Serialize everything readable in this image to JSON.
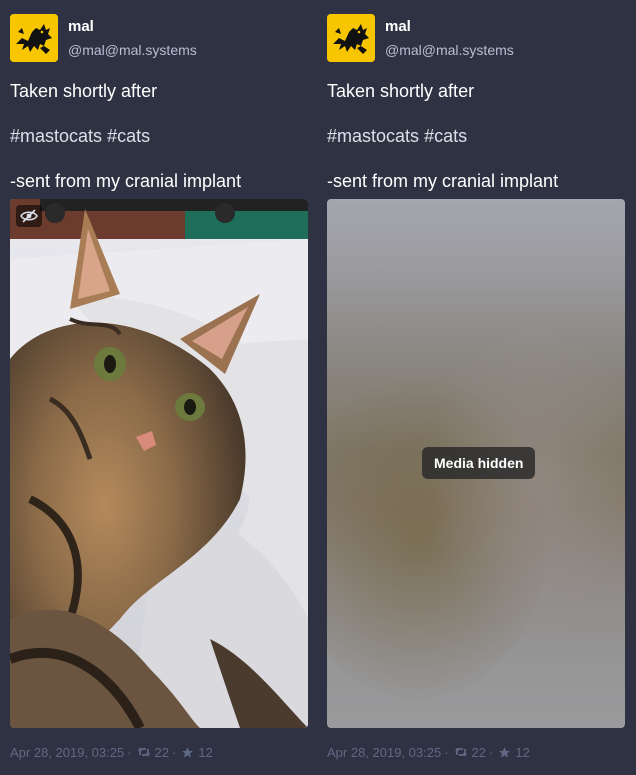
{
  "statuses": [
    {
      "author": {
        "display_name": "mal",
        "acct": "@mal@mal.systems",
        "avatar_icon": "black-cat-silhouette-icon"
      },
      "content": {
        "line1": "Taken shortly after",
        "hashtags": [
          "#mastocats",
          "#cats"
        ],
        "line3": "-sent from my cranial implant"
      },
      "media": {
        "state": "shown",
        "toggle_icon": "eye-slash-icon"
      },
      "footer": {
        "timestamp": "Apr 28, 2019, 03:25",
        "boosts": "22",
        "favourites": "12",
        "separator": "·"
      }
    },
    {
      "author": {
        "display_name": "mal",
        "acct": "@mal@mal.systems",
        "avatar_icon": "black-cat-silhouette-icon"
      },
      "content": {
        "line1": "Taken shortly after",
        "hashtags": [
          "#mastocats",
          "#cats"
        ],
        "line3": "-sent from my cranial implant"
      },
      "media": {
        "state": "hidden",
        "hidden_label": "Media hidden"
      },
      "footer": {
        "timestamp": "Apr 28, 2019, 03:25",
        "boosts": "22",
        "favourites": "12",
        "separator": "·"
      }
    }
  ],
  "colors": {
    "background": "#2f3242",
    "text": "#ffffff",
    "muted": "#606984",
    "account": "#b9bed2",
    "avatar_bg": "#f7c600"
  }
}
